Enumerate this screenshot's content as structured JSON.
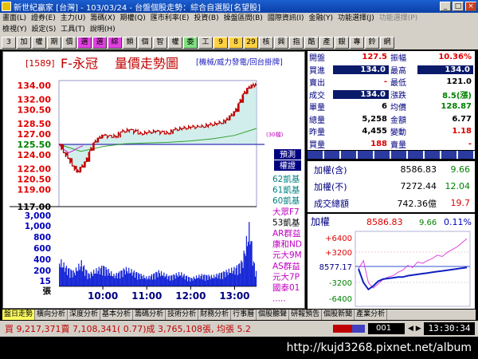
{
  "window": {
    "title": "新世紀贏家 [台灣] - 103/03/24 - 台盤個股走勢：綜合自選股[名望股]",
    "min": "_",
    "max": "□",
    "close": "×"
  },
  "menu1": [
    "畫面(L)",
    "證券(E)",
    "主力(U)",
    "籌碼(X)",
    "期權(Q)",
    "匯市利率(E)",
    "投資(B)",
    "操盤區間(B)",
    "國際資訊(I)",
    "金融(Y)",
    "功能選擇(J)",
    "功能選擇(P)"
  ],
  "menu2": [
    "檢視(Y)",
    "設定(S)",
    "工具(T)",
    "說明(H)"
  ],
  "toolbar": [
    "3",
    "加",
    "權",
    "期",
    "價",
    "選",
    "選",
    "綜",
    "類",
    "個",
    "智",
    "權",
    "委",
    "工",
    "9",
    "8",
    "29",
    "核",
    "興",
    "指",
    "酷",
    "產",
    "銀",
    "專",
    "鈴",
    "網"
  ],
  "chart": {
    "code": "[1589]",
    "name": "F-永冠",
    "subtitle": "量價走勢圖",
    "menu_links": "[機械/威力發電/回台掛牌]",
    "price_ticks": [
      "134.00",
      "132.00",
      "130.50",
      "128.50",
      "127.00",
      "125.50",
      "124.00",
      "122.00",
      "120.50",
      "119.00",
      "117.00"
    ],
    "volume_ticks": [
      "3,000",
      "1,000",
      "800",
      "600",
      "400",
      "200",
      "15",
      "張"
    ],
    "time_ticks": [
      "10:00",
      "11:00",
      "12:00",
      "13:00"
    ],
    "unit_tag": "(30檔)",
    "side_labels": [
      "預測",
      "權證"
    ],
    "legend": [
      "62凱基",
      "61凱基",
      "60凱基",
      "大眾F7",
      "53凱基",
      "AR群益",
      "康和ND",
      "元大9M",
      "AS群益",
      "元大7P",
      "國泰01",
      "....."
    ]
  },
  "chart_data": {
    "type": "line",
    "title": "量價走勢圖",
    "x_unit": "time",
    "x_range": [
      "09:00",
      "13:30"
    ],
    "ylim": [
      117.0,
      134.0
    ],
    "reference_price": 125.5,
    "series": [
      {
        "values_time": [
          "09:00",
          "09:06",
          "09:12",
          "09:18",
          "09:24",
          "09:30",
          "09:36",
          "09:42",
          "09:48",
          "09:54",
          "10:00",
          "10:12",
          "10:24",
          "10:36",
          "10:48",
          "11:00",
          "11:12",
          "11:24",
          "11:36",
          "11:48",
          "12:00",
          "12:12",
          "12:24",
          "12:36",
          "12:48",
          "12:54",
          "13:00",
          "13:06",
          "13:12",
          "13:18",
          "13:24",
          "13:30"
        ],
        "values": [
          125.5,
          124.3,
          123.5,
          122.4,
          121.5,
          122.2,
          123.0,
          124.6,
          125.8,
          126.4,
          126.8,
          126.5,
          127.3,
          127.6,
          127.0,
          127.2,
          127.4,
          127.0,
          127.6,
          127.8,
          128.0,
          128.0,
          128.3,
          128.5,
          129.0,
          129.6,
          130.2,
          131.5,
          132.8,
          133.6,
          134.0,
          134.0
        ]
      },
      {
        "values_time": [
          "09:00",
          "09:30",
          "10:00",
          "10:30",
          "11:00",
          "11:30",
          "12:00",
          "12:30",
          "13:00",
          "13:30"
        ],
        "values": [
          125.5,
          124.5,
          125.2,
          125.6,
          125.7,
          125.8,
          126.0,
          126.3,
          126.8,
          127.8
        ]
      }
    ],
    "volume": {
      "time": [
        "09:00",
        "09:10",
        "09:20",
        "09:30",
        "09:40",
        "09:50",
        "10:00",
        "10:15",
        "10:30",
        "10:45",
        "11:00",
        "11:15",
        "11:30",
        "11:45",
        "12:00",
        "12:15",
        "12:30",
        "12:45",
        "13:00",
        "13:10",
        "13:20",
        "13:25",
        "13:30"
      ],
      "values": [
        900,
        650,
        500,
        820,
        420,
        560,
        700,
        380,
        620,
        480,
        300,
        520,
        350,
        460,
        280,
        400,
        350,
        500,
        620,
        880,
        2100,
        900,
        400
      ]
    }
  },
  "quote": {
    "rows": [
      [
        {
          "label": "開盤",
          "value": "127.5",
          "color": "red"
        },
        {
          "label": "振幅",
          "value": "10.36%",
          "color": "red"
        }
      ],
      [
        {
          "label": "買進",
          "value": "134.0",
          "boxed": true
        },
        {
          "label": "最高",
          "value": "134.0",
          "boxed": true
        }
      ],
      [
        {
          "label": "賣出",
          "value": "-",
          "color": "red"
        },
        {
          "label": "最低",
          "value": "121.0",
          "color": "black"
        }
      ],
      [
        {
          "label": "成交",
          "value": "134.0",
          "boxed": true
        },
        {
          "label": "漲跌",
          "value": "8.5(漲)",
          "color": "green"
        }
      ],
      [
        {
          "label": "單量",
          "value": "6",
          "color": "black"
        },
        {
          "label": "均價",
          "value": "128.87",
          "color": "green"
        }
      ],
      [
        {
          "label": "總量",
          "value": "5,258",
          "color": "black"
        },
        {
          "label": "金額",
          "value": "6.77",
          "color": "black"
        }
      ],
      [
        {
          "label": "昨量",
          "value": "4,455",
          "color": "black"
        },
        {
          "label": "變動",
          "value": "1.18",
          "color": "red"
        }
      ],
      [
        {
          "label": "買量",
          "value": "188",
          "color": "red"
        },
        {
          "label": "賣量",
          "value": "-",
          "color": "red"
        }
      ]
    ]
  },
  "index_box": [
    {
      "label": "加權(含)",
      "value": "8586.83",
      "change": "9.66",
      "color": "green"
    },
    {
      "label": "加權(不)",
      "value": "7272.44",
      "change": "12.04",
      "color": "green"
    },
    {
      "label": "成交總額",
      "value": "742.36億",
      "change": "19.7",
      "color": "red"
    }
  ],
  "mini": {
    "label": "加權",
    "value": "8586.83",
    "change": "9.66",
    "pct": "0.11%",
    "ticks": [
      "+6400",
      "+3200",
      "8577.17",
      "-3200",
      "-6400"
    ]
  },
  "mini_chart_data": {
    "type": "line",
    "series": [
      {
        "values": [
          0.5,
          0.62,
          0.3,
          0.22,
          0.28,
          0.35,
          0.38,
          0.4,
          0.45,
          0.48,
          0.55,
          0.52,
          0.6,
          0.58,
          0.62,
          0.65,
          0.7,
          0.68,
          0.74,
          0.78,
          0.82,
          0.88,
          0.94
        ]
      },
      {
        "values": [
          0.5,
          0.3,
          0.2,
          0.25,
          0.32,
          0.35,
          0.36,
          0.37,
          0.38,
          0.38,
          0.4,
          0.41,
          0.42,
          0.43,
          0.44,
          0.45,
          0.46,
          0.47,
          0.48,
          0.49,
          0.5,
          0.51,
          0.52
        ]
      }
    ]
  },
  "tabs": [
    "盤日走勢",
    "橫向分析",
    "深度分析",
    "基本分析",
    "籌碼分析",
    "技術分析",
    "財務分析",
    "行事曆",
    "個股聽聲",
    "研報預告",
    "個股新聞",
    "產業分析"
  ],
  "status": {
    "text": "買 9,217,371賣 7,108,341( 0.77)成 3,765,108張, 均張 5.2",
    "page": "001",
    "arrows": "◀ ▶",
    "clock": "13:30:34"
  },
  "watermark": "http://kujd3268.pixnet.net/album",
  "colors": {
    "up": "#e00000",
    "down": "#008000",
    "price": "#c00000",
    "avg": "#30a030",
    "fill": "#bfe7e4",
    "volume": "#1a2ad8",
    "ref": "#5050c0"
  }
}
